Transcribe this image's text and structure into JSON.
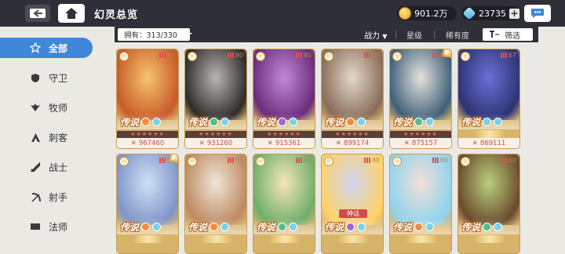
{
  "header": {
    "title": "幻灵总览",
    "gold": "901.2万",
    "gems": "23735"
  },
  "sidebar": {
    "items": [
      {
        "label": "全部",
        "icon": "star-icon",
        "active": true
      },
      {
        "label": "守卫",
        "icon": "shield-icon",
        "active": false
      },
      {
        "label": "牧师",
        "icon": "wings-icon",
        "active": false
      },
      {
        "label": "刺客",
        "icon": "dagger-icon",
        "active": false
      },
      {
        "label": "战士",
        "icon": "sword-icon",
        "active": false
      },
      {
        "label": "射手",
        "icon": "bow-icon",
        "active": false
      },
      {
        "label": "法师",
        "icon": "book-icon",
        "active": false
      }
    ]
  },
  "filterbar": {
    "owned": "拥有：313/330",
    "sort_power": "战力",
    "sort_star": "星级",
    "sort_rarity": "稀有度",
    "filter": "筛选"
  },
  "cards": [
    {
      "level": "80",
      "rank": "传说",
      "power": "967460",
      "new": "",
      "ribbon": "",
      "art": [
        "#f7c46b",
        "#c85a2a"
      ],
      "els": [
        "#f28b3b",
        "#7ad1e8"
      ],
      "stars": "★★★★★★"
    },
    {
      "level": "80",
      "rank": "传说",
      "power": "931260",
      "new": "",
      "ribbon": "",
      "art": [
        "#b9b5b2",
        "#2e2b2b"
      ],
      "els": [
        "#4fbf8d",
        "#7ad1e8"
      ],
      "stars": "★★★★★★"
    },
    {
      "level": "80",
      "rank": "传说",
      "power": "915361",
      "new": "",
      "ribbon": "",
      "art": [
        "#c08ad8",
        "#6a2c7a"
      ],
      "els": [
        "#9a6ad8",
        "#7ad1e8"
      ],
      "stars": "★★★★★★"
    },
    {
      "level": "80",
      "rank": "传说",
      "power": "899174",
      "new": "",
      "ribbon": "",
      "art": [
        "#e2d8cd",
        "#8a6b57"
      ],
      "els": [
        "#f28b3b",
        "#7ad1e8"
      ],
      "stars": "★★★★★★"
    },
    {
      "level": "80",
      "rank": "传说",
      "power": "875157",
      "new": "新",
      "ribbon": "",
      "art": [
        "#e6e3dd",
        "#3e5f7a"
      ],
      "els": [
        "#4fbf8d",
        "#7ad1e8"
      ],
      "stars": "★★★★★★"
    },
    {
      "level": "67",
      "rank": "传说",
      "power": "869111",
      "new": "",
      "ribbon": "",
      "art": [
        "#6a6fd6",
        "#2d3373"
      ],
      "els": [
        "#7ad1e8",
        "#7ad1e8"
      ],
      "stars": ""
    },
    {
      "level": "80",
      "rank": "传说",
      "power": "",
      "new": "新",
      "ribbon": "",
      "art": [
        "#cfe0f6",
        "#7f95c8"
      ],
      "els": [
        "#f28b3b",
        "#7ad1e8"
      ],
      "stars": ""
    },
    {
      "level": "80",
      "rank": "传说",
      "power": "",
      "new": "",
      "ribbon": "",
      "art": [
        "#efe6d6",
        "#bf8a62"
      ],
      "els": [
        "#f28b3b",
        "#7ad1e8"
      ],
      "stars": ""
    },
    {
      "level": "67",
      "rank": "传说",
      "power": "",
      "new": "",
      "ribbon": "",
      "art": [
        "#f4e7b7",
        "#6fae6c"
      ],
      "els": [
        "#4fbf8d",
        "#7ad1e8"
      ],
      "stars": ""
    },
    {
      "level": "80",
      "rank": "传说",
      "power": "",
      "new": "",
      "ribbon": "神话",
      "art": [
        "#cfd6f3",
        "#ffd36a"
      ],
      "els": [
        "#9a6ad8",
        "#7ad1e8"
      ],
      "stars": ""
    },
    {
      "level": "60",
      "rank": "传说",
      "power": "",
      "new": "",
      "ribbon": "",
      "art": [
        "#f4dfd4",
        "#8fd4ef"
      ],
      "els": [
        "#f28b3b",
        "#7ad1e8"
      ],
      "stars": ""
    },
    {
      "level": "60",
      "rank": "传说",
      "power": "",
      "new": "",
      "ribbon": "",
      "art": [
        "#b9cf7d",
        "#6a4a2c"
      ],
      "els": [
        "#4fbf8d",
        "#7ad1e8"
      ],
      "stars": ""
    }
  ]
}
